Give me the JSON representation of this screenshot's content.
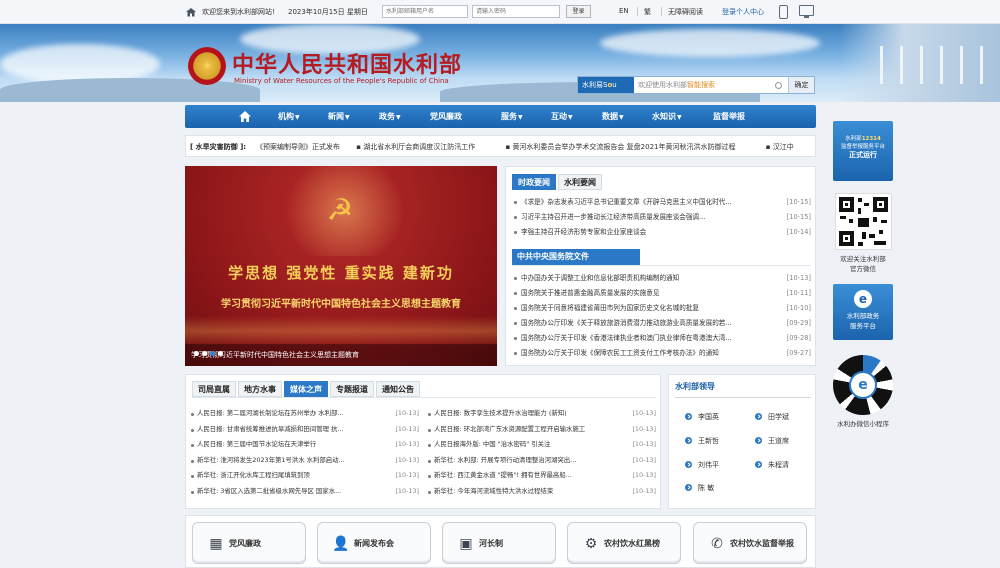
{
  "topbar": {
    "welcome": "欢迎您来到水利部网站!",
    "date": "2023年10月15日 星期日",
    "username_placeholder": "水利部邮箱用户名",
    "password_placeholder": "请输入密码",
    "login": "登录",
    "en": "EN",
    "traditional": "繁",
    "accessible": "无障碍阅读",
    "personal": "登录个人中心"
  },
  "header": {
    "title": "中华人民共和国水利部",
    "subtitle": "Ministry of Water Resources of the People's Republic of China"
  },
  "search": {
    "label_a": "水利易",
    "label_b": "S",
    "label_c": "o",
    "label_d": "u",
    "placeholder_a": "欢迎使用水利部",
    "placeholder_b": "智能搜索",
    "ok": "确定"
  },
  "nav": {
    "items": [
      "机构",
      "新闻",
      "政务",
      "党风廉政",
      "服务",
      "互动",
      "数据",
      "水知识",
      "监督举报"
    ]
  },
  "ticker": {
    "head": "[ 水旱灾害防御 ]:",
    "items": [
      "《预案编制导则》正式发布",
      "湖北省水利厅会商调度汉江防汛工作",
      "黄河水利委员会举办学术交流报告会 复盘2021年黄河秋汛洪水防御过程",
      "汉江中"
    ]
  },
  "slider": {
    "slogan": "学思想 强党性 重实践 建新功",
    "theme": "学习贯彻习近平新时代中国特色社会主义思想主题教育",
    "caption": "学习贯彻习近平新时代中国特色社会主义思想主题教育"
  },
  "news": {
    "tabs": [
      "时政要闻",
      "水利要闻"
    ],
    "politics": [
      {
        "title": "《求是》杂志发表习近平总书记重要文章《开辟马克思主义中国化时代...",
        "date": "[10-15]"
      },
      {
        "title": "习近平主持召开进一步推动长江经济带高质量发展座谈会强调...",
        "date": "[10-15]"
      },
      {
        "title": "李强主持召开经济形势专家和企业家座谈会",
        "date": "[10-14]"
      }
    ],
    "docs_title": "中共中央国务院文件",
    "docs": [
      {
        "title": "中办国办关于调整工业和信息化部职责机构编制的通知",
        "date": "[10-13]"
      },
      {
        "title": "国务院关于推进普惠金融高质量发展的实施意见",
        "date": "[10-11]"
      },
      {
        "title": "国务院关于同意将福建省莆田市列为国家历史文化名城的批复",
        "date": "[10-10]"
      },
      {
        "title": "国务院办公厅印发《关于释放旅游消费潜力推动旅游业高质量发展的若...",
        "date": "[09-29]"
      },
      {
        "title": "国务院办公厅关于印发《香港法律执业者和澳门执业律师在粤港澳大湾...",
        "date": "[09-28]"
      },
      {
        "title": "国务院办公厅关于印发《保障农民工工资支付工作考核办法》的通知",
        "date": "[09-27]"
      }
    ]
  },
  "media": {
    "tabs": [
      "司局直属",
      "地方水事",
      "媒体之声",
      "专题报道",
      "通知公告"
    ],
    "left": [
      {
        "title": "人民日报: 第二届河湖长制论坛在苏州举办 水利部...",
        "date": "[10-13]"
      },
      {
        "title": "人民日报: 甘肃省统筹推进抗旱减损和田间管理 抗...",
        "date": "[10-13]"
      },
      {
        "title": "人民日报: 第三届中国节水论坛在天津举行",
        "date": "[10-13]"
      },
      {
        "title": "新华社: 淮河将发生2023年第1号洪水 水利部启动...",
        "date": "[10-13]"
      },
      {
        "title": "新华社: 浙江开化水库工程扫尾填筑到顶",
        "date": "[10-13]"
      },
      {
        "title": "新华社: 3省区入选第二批省级水网先导区 国家水...",
        "date": "[10-13]"
      }
    ],
    "right": [
      {
        "title": "人民日报: 数字孪生技术提升水治理能力 (新知)",
        "date": "[10-13]"
      },
      {
        "title": "人民日报: 环北部湾广东水资源配置工程开启输水施工",
        "date": "[10-13]"
      },
      {
        "title": "人民日报海外版: 中国 \"治水密码\" 引关注",
        "date": "[10-13]"
      },
      {
        "title": "新华社: 水利部: 开展专项行动清理整治河湖突出...",
        "date": "[10-13]"
      },
      {
        "title": "新华社: 西江黄金水道 \"提畅\"! 拥有世界最高船...",
        "date": "[10-13]"
      },
      {
        "title": "新华社: 今年海河流域性特大洪水过程结束",
        "date": "[10-13]"
      }
    ]
  },
  "leaders": {
    "title": "水利部领导",
    "names": [
      "李国英",
      "田学斌",
      "王新哲",
      "王道席",
      "刘伟平",
      "朱程清",
      "陈 敏"
    ]
  },
  "quick": {
    "items": [
      {
        "label": "党风廉政",
        "icon": "building-icon"
      },
      {
        "label": "新闻发布会",
        "icon": "user-icon"
      },
      {
        "label": "河长制",
        "icon": "id-card-icon"
      },
      {
        "label": "农村饮水红黑榜",
        "icon": "water-tap-icon"
      },
      {
        "label": "农村饮水监督举报",
        "icon": "phone-icon"
      }
    ]
  },
  "side": {
    "card1_line1_a": "水利部",
    "card1_line1_b": "12314",
    "card1_line2": "监督举报服务平台",
    "card1_line3": "正式运行",
    "qr_caption_1": "欢迎关注水利部",
    "qr_caption_2": "官方微信",
    "card2_line1": "水利部政务",
    "card2_line2": "服务平台",
    "mini_caption": "水利办微信小程序"
  }
}
